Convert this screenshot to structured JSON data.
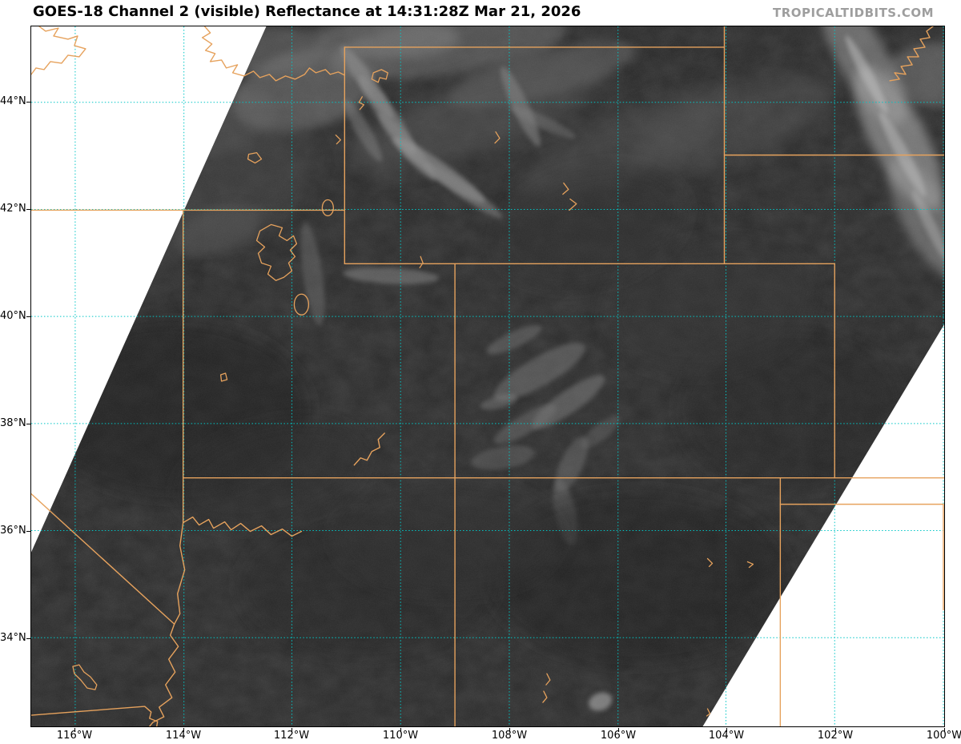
{
  "header": {
    "title": "GOES-18 Channel 2 (visible) Reflectance at 14:31:28Z Mar 21, 2026",
    "watermark": "TROPICALTIDBITS.COM"
  },
  "axes": {
    "lat_labels": [
      "44°N",
      "42°N",
      "40°N",
      "38°N",
      "36°N",
      "34°N"
    ],
    "lon_labels": [
      "116°W",
      "114°W",
      "112°W",
      "110°W",
      "108°W",
      "106°W",
      "104°W",
      "102°W",
      "100°W"
    ]
  },
  "map": {
    "layers": {
      "satellite_imagery": "GOES-18 visible reflectance (dark pre-sunrise land with cloud/snow features)",
      "graticule": "latitude/longitude grid every 2 degrees, dotted",
      "borders": "US state borders, rivers and lakes overlay"
    }
  },
  "colors": {
    "background": "#ffffff",
    "title_text": "#000000",
    "watermark_text": "#9e9e9e",
    "swath_base": "#282828",
    "graticule": "#00c6c6",
    "state_border": "#e6a25d",
    "axis_text": "#000000"
  }
}
